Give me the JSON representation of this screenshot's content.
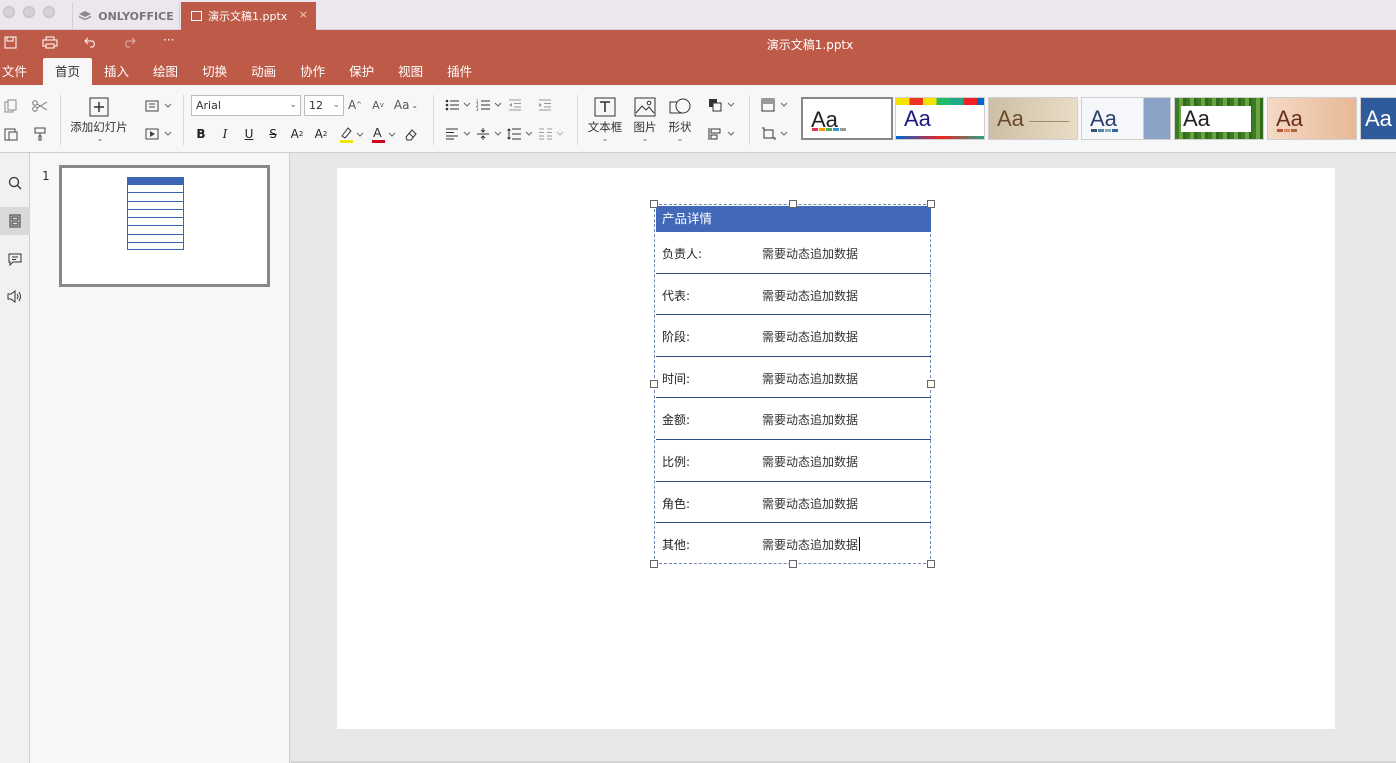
{
  "titlebar": {
    "app_tab": "ONLYOFFICE",
    "doc_tab": "演示文稿1.pptx",
    "close_glyph": "×"
  },
  "header": {
    "doc_title": "演示文稿1.pptx",
    "quick_more": "···"
  },
  "menu": {
    "items": [
      "文件",
      "首页",
      "插入",
      "绘图",
      "切换",
      "动画",
      "协作",
      "保护",
      "视图",
      "插件"
    ],
    "active": "首页"
  },
  "ribbon": {
    "add_slide_label": "添加幻灯片",
    "font_name": "Arial",
    "font_size": "12",
    "textbox_label": "文本框",
    "image_label": "图片",
    "shape_label": "形状",
    "theme_sample": "Aa"
  },
  "slides_panel": {
    "slide_number": "1"
  },
  "table": {
    "header": "产品详情",
    "rows": [
      {
        "key": "负责人:",
        "value": "需要动态追加数据"
      },
      {
        "key": "代表:",
        "value": "需要动态追加数据"
      },
      {
        "key": "阶段:",
        "value": "需要动态追加数据"
      },
      {
        "key": "时间:",
        "value": "需要动态追加数据"
      },
      {
        "key": "金额:",
        "value": "需要动态追加数据"
      },
      {
        "key": "比例:",
        "value": "需要动态追加数据"
      },
      {
        "key": "角色:",
        "value": "需要动态追加数据"
      },
      {
        "key": "其他:",
        "value": "需要动态追加数据"
      }
    ]
  },
  "colors": {
    "accent": "#be5b48",
    "table_header": "#4169b8"
  }
}
